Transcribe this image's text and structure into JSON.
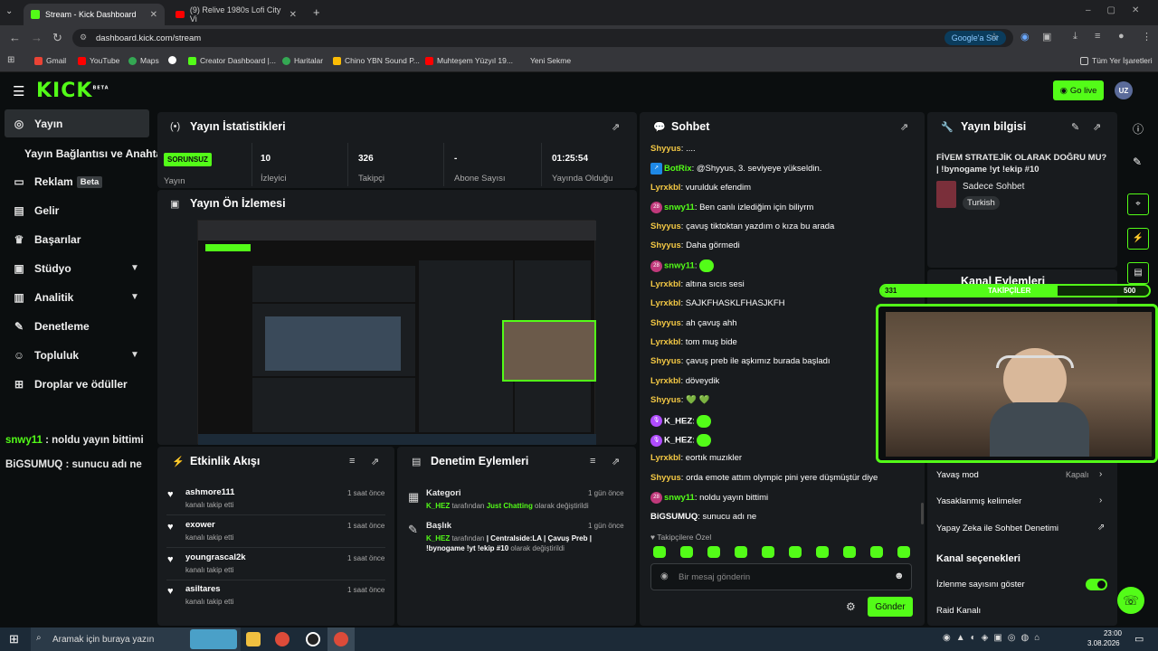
{
  "browser": {
    "tabs": [
      {
        "title": "Stream - Kick Dashboard"
      },
      {
        "title": "(9) Relive 1980s Lofi City Vi"
      }
    ],
    "url": "dashboard.kick.com/stream",
    "google_sor": "Google'a Sor",
    "bookmarks": [
      "Gmail",
      "YouTube",
      "Maps",
      "Creator Dashboard |...",
      "Haritalar",
      "Chino YBN Sound P...",
      "Muhteşem Yüzyıl 19...",
      "Yeni Sekme"
    ],
    "all_bookmarks": "Tüm Yer İşaretleri"
  },
  "header": {
    "logo": "KICK",
    "beta": "BETA",
    "go_live": "Go live",
    "avatar": "UZ"
  },
  "sidebar": {
    "items": [
      {
        "label": "Yayın"
      },
      {
        "label": "Yayın Bağlantısı ve Anahtarı"
      },
      {
        "label": "Reklam",
        "badge": "Beta"
      },
      {
        "label": "Gelir"
      },
      {
        "label": "Başarılar"
      },
      {
        "label": "Stüdyo"
      },
      {
        "label": "Analitik"
      },
      {
        "label": "Denetleme"
      },
      {
        "label": "Topluluk"
      },
      {
        "label": "Droplar ve ödüller"
      }
    ]
  },
  "overlay_chat": [
    {
      "user": "snwy11",
      "text": " : noldu yayın bittimi"
    },
    {
      "user": "BiGSUMUQ",
      "text": " : sunucu adı ne"
    }
  ],
  "stats": {
    "title": "Yayın İstatistikleri",
    "status": "SORUNSUZ",
    "status_label": "Yayın",
    "items": [
      {
        "value": "10",
        "label": "İzleyici"
      },
      {
        "value": "326",
        "label": "Takipçi"
      },
      {
        "value": "-",
        "label": "Abone Sayısı"
      },
      {
        "value": "01:25:54",
        "label": "Yayında Olduğu"
      }
    ]
  },
  "preview": {
    "title": "Yayın Ön İzlemesi"
  },
  "activity": {
    "title": "Etkinlik Akışı",
    "items": [
      {
        "name": "ashmore111",
        "sub": "kanalı takip etti",
        "time": "1 saat önce"
      },
      {
        "name": "exower",
        "sub": "kanalı takip etti",
        "time": "1 saat önce"
      },
      {
        "name": "youngrascal2k",
        "sub": "kanalı takip etti",
        "time": "1 saat önce"
      },
      {
        "name": "asiltares",
        "sub": "kanalı takip etti",
        "time": "1 saat önce"
      }
    ]
  },
  "moderation": {
    "title": "Denetim Eylemleri",
    "items": [
      {
        "heading": "Kategori",
        "time": "1 gün önce",
        "actor": "K_HEZ",
        "mid": " tarafından ",
        "value": "Just Chatting",
        "tail": " olarak değiştirildi"
      },
      {
        "heading": "Başlık",
        "time": "1 gün önce",
        "actor": "K_HEZ",
        "mid": " tarafından ",
        "value": "| Centralside:LA | Çavuş Preb | !bynogame !yt !ekip #10",
        "tail": " olarak değiştirildi"
      }
    ]
  },
  "chat": {
    "title": "Sohbet",
    "messages": [
      {
        "user": "Shyyus",
        "text": ": ...."
      },
      {
        "user": "BotRix",
        "text": ": @Shyyus, 3. seviyeye yükseldin."
      },
      {
        "user": "Lyrxkbl",
        "text": ": vurulduk efendim"
      },
      {
        "user": "snwy11",
        "text": ": Ben canlı izlediğim için biliyrm"
      },
      {
        "user": "Shyyus",
        "text": ": çavuş tiktoktan yazdım o kıza bu arada"
      },
      {
        "user": "Shyyus",
        "text": ": Daha görmedi"
      },
      {
        "user": "snwy11",
        "text": ": "
      },
      {
        "user": "Lyrxkbl",
        "text": ": altına sıcıs sesi"
      },
      {
        "user": "Lyrxkbl",
        "text": ": SAJKFHASKLFHASJKFH"
      },
      {
        "user": "Shyyus",
        "text": ": ah çavuş ahh"
      },
      {
        "user": "Lyrxkbl",
        "text": ": tom muş bide"
      },
      {
        "user": "Shyyus",
        "text": ": çavuş preb ile aşkımız burada başladı"
      },
      {
        "user": "Lyrxkbl",
        "text": ": döveydik"
      },
      {
        "user": "Shyyus",
        "text": ": 💚 💚"
      },
      {
        "user": "K_HEZ",
        "text": ": "
      },
      {
        "user": "K_HEZ",
        "text": ": "
      },
      {
        "user": "Lyrxkbl",
        "text": ": eortık muzıkler"
      },
      {
        "user": "Shyyus",
        "text": ": orda emote attım olympic pini yere düşmüştür diye"
      },
      {
        "user": "snwy11",
        "text": ": noldu yayın bittimi"
      },
      {
        "user": "BiGSUMUQ",
        "text": ": sunucu adı ne"
      }
    ],
    "emote_section": "Takipçilere Özel",
    "input_placeholder": "Bir mesaj gönderin",
    "send": "Gönder"
  },
  "stream_info": {
    "title": "Yayın bilgisi",
    "stream_title": "FİVEM STRATEJİK OLARAK DOĞRU MU? | !bynogame !yt !ekip #10",
    "category": "Sadece Sohbet",
    "tag": "Turkish"
  },
  "channel_actions": {
    "title": "Kanal Eylemleri",
    "goal_label": "TAKİPÇİLER",
    "goal_current": "331",
    "goal_target": "500",
    "goal_progress": 0.66
  },
  "chat_settings": [
    {
      "label": "Yavaş mod",
      "value": "Kapalı"
    },
    {
      "label": "Yasaklanmış kelimeler"
    },
    {
      "label": "Yapay Zeka ile Sohbet Denetimi"
    }
  ],
  "channel_options": {
    "title": "Kanal seçenekleri",
    "items": [
      "İzlenme sayısını göster",
      "Raid Kanalı"
    ]
  },
  "taskbar": {
    "search": "Aramak için buraya yazın",
    "time": "23:00",
    "date": "3.08.2026"
  },
  "colors": {
    "accent": "#53fc18",
    "panel": "#181b1e",
    "bg": "#0b0e0f"
  }
}
